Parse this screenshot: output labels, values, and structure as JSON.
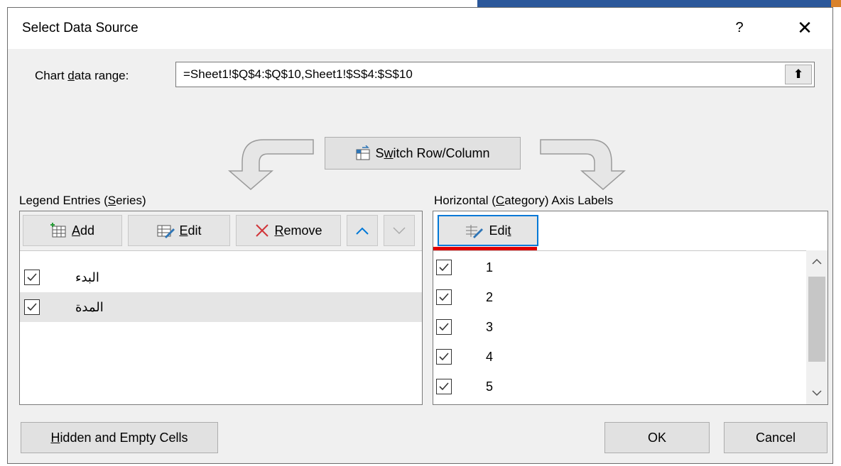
{
  "dialog": {
    "title": "Select Data Source",
    "help_glyph": "?",
    "close_glyph": "✕"
  },
  "range": {
    "label_pre": "Chart ",
    "label_accel": "d",
    "label_post": "ata range:",
    "value": "=Sheet1!$Q$4:$Q$10,Sheet1!$S$4:$S$10",
    "collapse_glyph": "⬆"
  },
  "switch": {
    "label_pre": "S",
    "label_accel": "w",
    "label_post": "itch Row/Column"
  },
  "legend": {
    "heading_pre": "Legend Entries (",
    "heading_accel": "S",
    "heading_post": "eries)",
    "add_accel": "A",
    "add_post": "dd",
    "edit_accel": "E",
    "edit_post": "dit",
    "remove_accel": "R",
    "remove_post": "emove",
    "items": [
      {
        "label": "البدء",
        "checked": true
      },
      {
        "label": "المدة",
        "checked": true
      }
    ]
  },
  "axis": {
    "heading_pre": "Horizontal (",
    "heading_accel": "C",
    "heading_post": "ategory) Axis Labels",
    "edit_pre": "Edi",
    "edit_accel": "t",
    "items": [
      {
        "label": "1",
        "checked": true
      },
      {
        "label": "2",
        "checked": true
      },
      {
        "label": "3",
        "checked": true
      },
      {
        "label": "4",
        "checked": true
      },
      {
        "label": "5",
        "checked": true
      }
    ]
  },
  "footer": {
    "hidden_accel": "H",
    "hidden_post": "idden and Empty Cells",
    "ok_label": "OK",
    "cancel_label": "Cancel"
  },
  "colors": {
    "accent": "#0078d7",
    "highlight": "#e00000"
  }
}
